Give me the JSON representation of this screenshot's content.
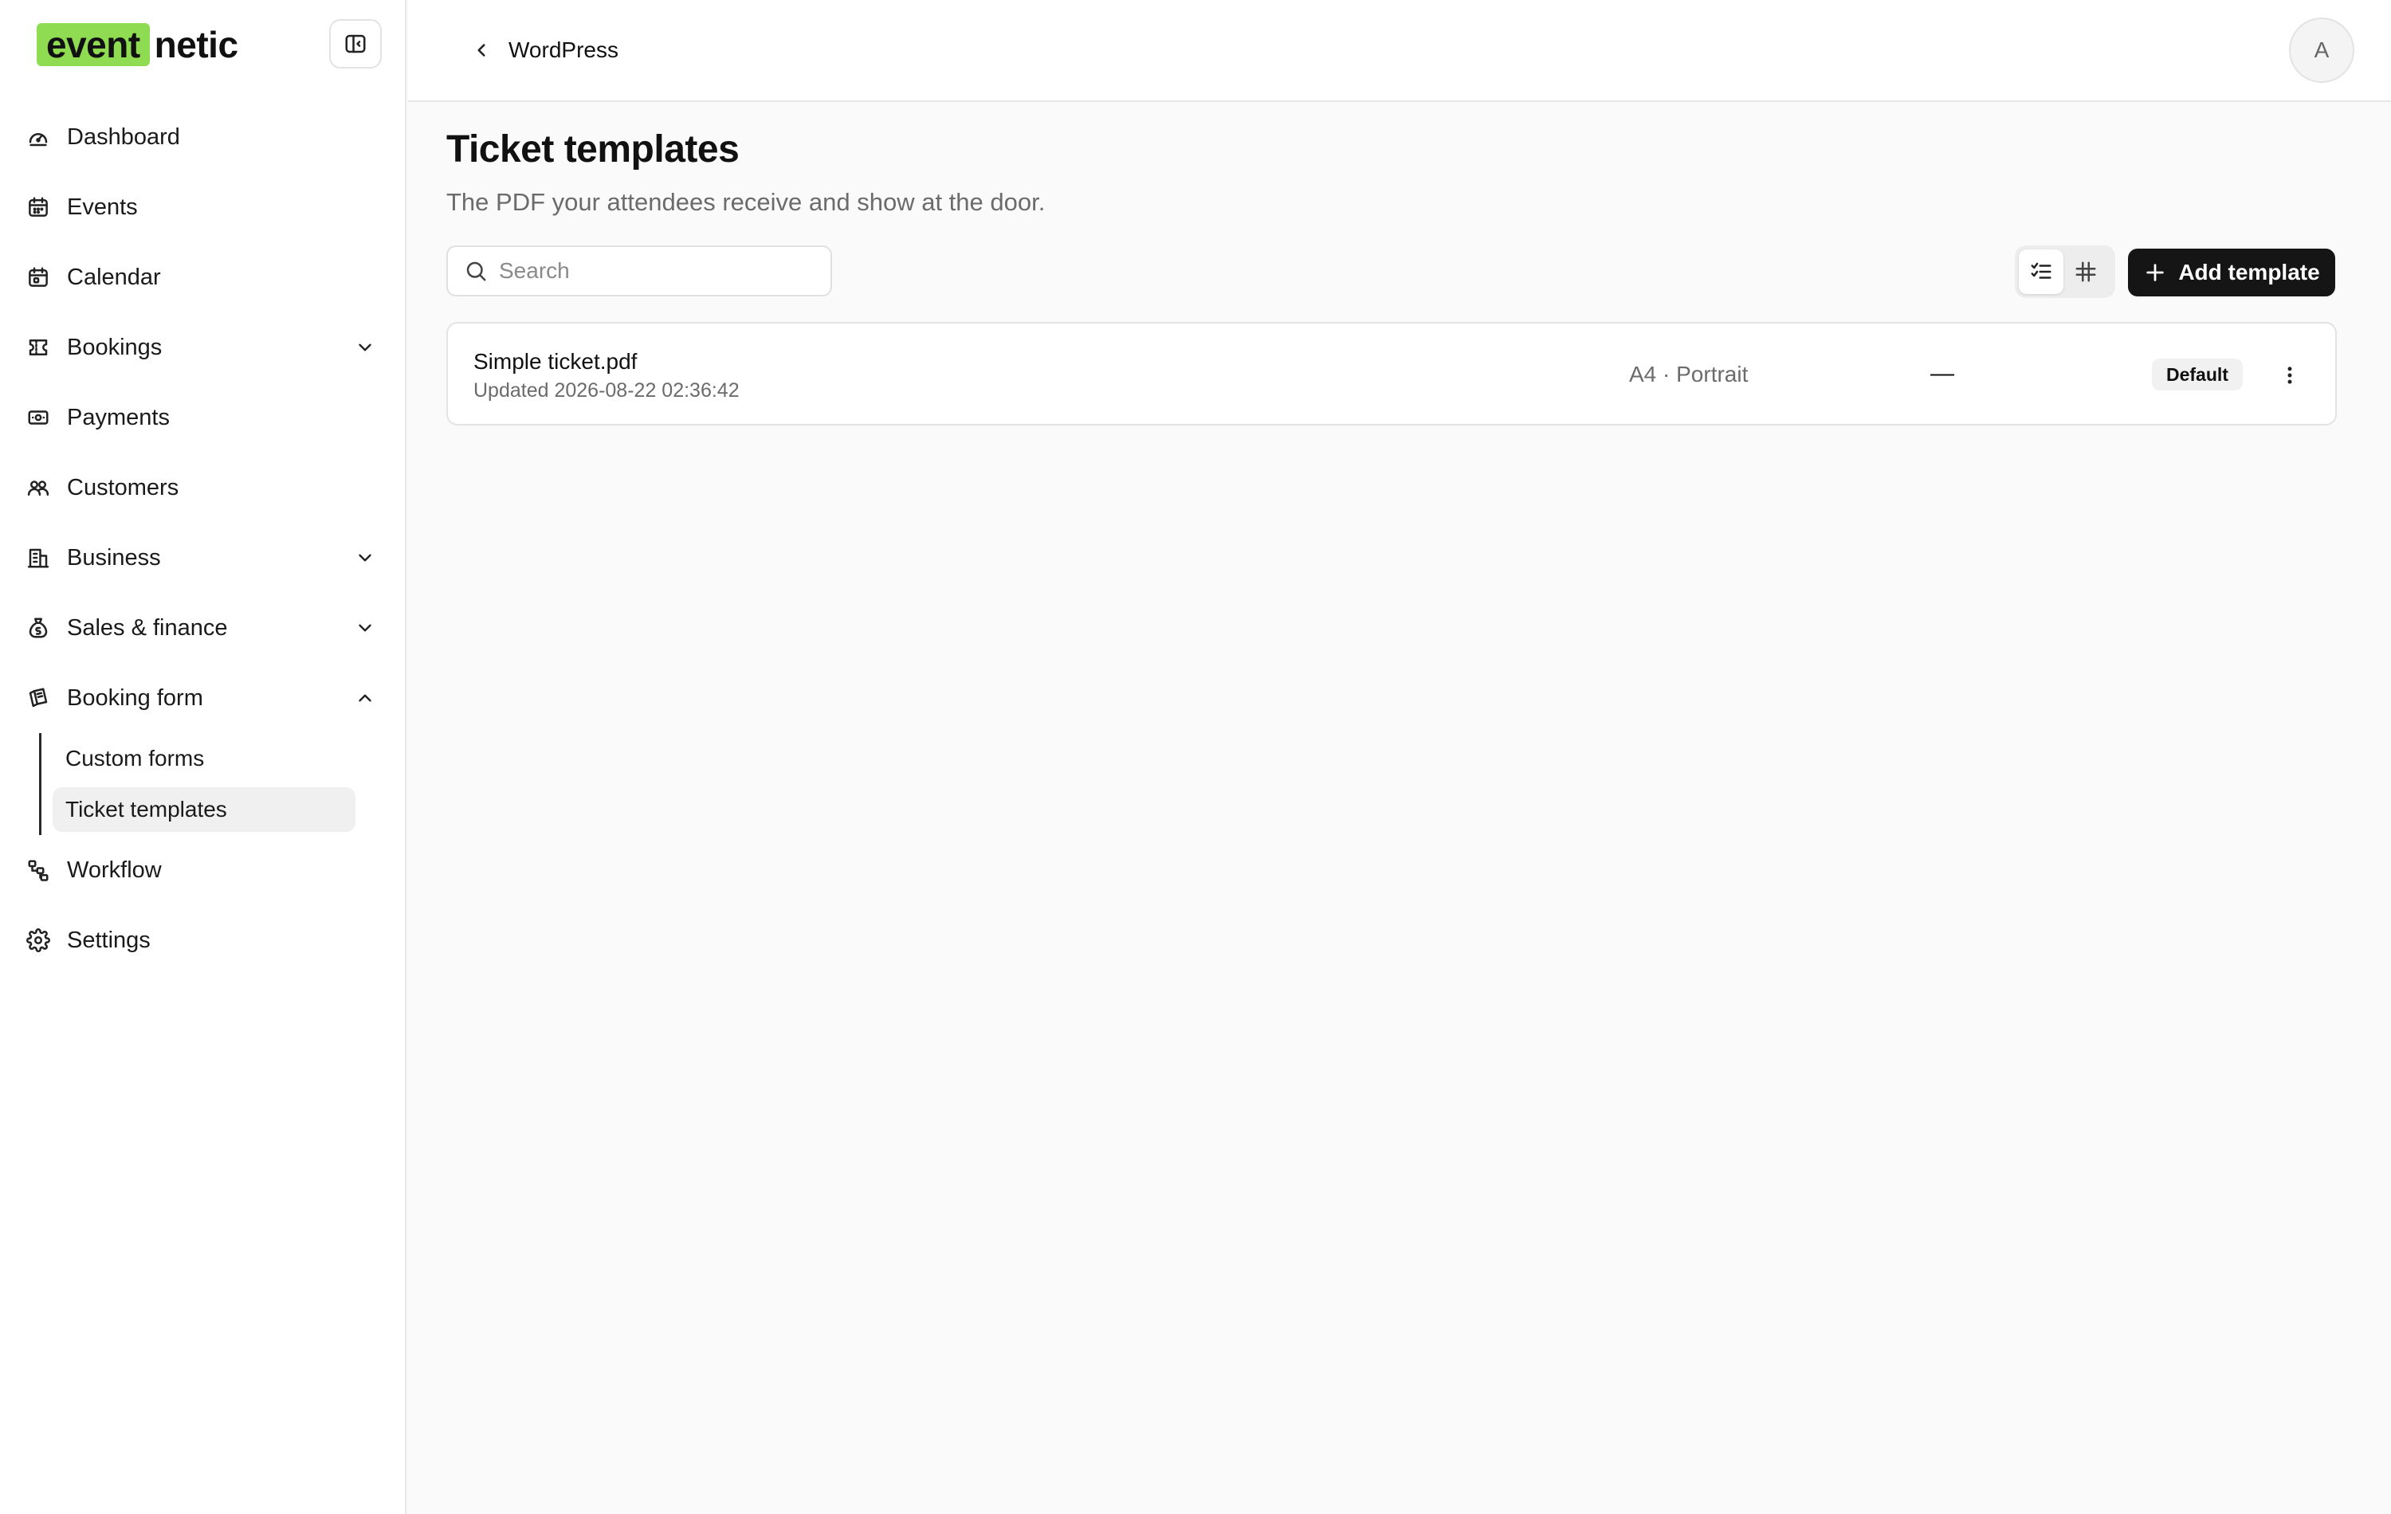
{
  "app": {
    "logo_highlight": "event",
    "logo_rest": "netic"
  },
  "sidebar": {
    "items": [
      {
        "label": "Dashboard",
        "icon": "gauge-icon"
      },
      {
        "label": "Events",
        "icon": "calendar-icon"
      },
      {
        "label": "Calendar",
        "icon": "calendar-grid-icon"
      },
      {
        "label": "Bookings",
        "icon": "ticket-icon",
        "expandable": true
      },
      {
        "label": "Payments",
        "icon": "banknote-icon"
      },
      {
        "label": "Customers",
        "icon": "users-icon"
      },
      {
        "label": "Business",
        "icon": "building-icon",
        "expandable": true
      },
      {
        "label": "Sales & finance",
        "icon": "money-bag-icon",
        "expandable": true
      },
      {
        "label": "Booking form",
        "icon": "form-icon",
        "expanded": true
      },
      {
        "label": "Workflow",
        "icon": "workflow-icon"
      },
      {
        "label": "Settings",
        "icon": "gear-icon"
      }
    ],
    "sub_items": [
      {
        "label": "Custom forms"
      },
      {
        "label": "Ticket templates",
        "active": true
      }
    ]
  },
  "header": {
    "back_label": "WordPress",
    "avatar_initial": "A"
  },
  "main": {
    "title": "Ticket templates",
    "subtitle": "The PDF your attendees receive and show at the door.",
    "search_placeholder": "Search",
    "add_button_label": "Add template",
    "view_mode": "list",
    "templates": [
      {
        "name": "Simple ticket.pdf",
        "updated": "Updated 2026-08-22 02:36:42",
        "paper": "A4 · Portrait",
        "extra": "—",
        "badge": "Default"
      }
    ]
  },
  "colors": {
    "brand_accent": "#8fdb52",
    "primary_button": "#151515"
  }
}
